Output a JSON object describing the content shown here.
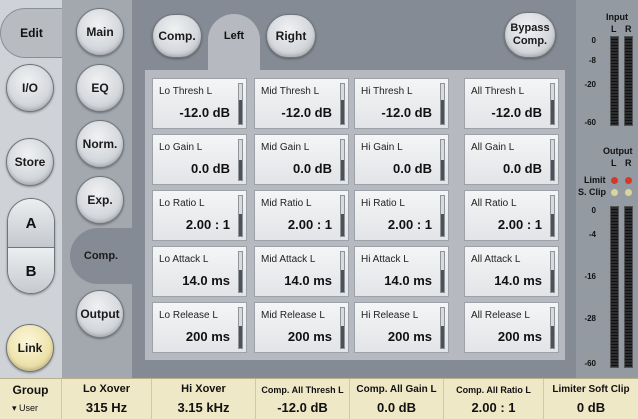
{
  "left_nav": {
    "edit": "Edit",
    "io": "I/O",
    "store": "Store",
    "a": "A",
    "b": "B",
    "link": "Link"
  },
  "sections": {
    "main": "Main",
    "eq": "EQ",
    "norm": "Norm.",
    "exp": "Exp.",
    "comp": "Comp.",
    "output": "Output"
  },
  "tabs": {
    "comp": "Comp.",
    "left": "Left",
    "right": "Right",
    "bypass_line1": "Bypass",
    "bypass_line2": "Comp."
  },
  "params": [
    [
      {
        "label": "Lo Thresh L",
        "value": "-12.0 dB",
        "level": 0.6
      },
      {
        "label": "Mid Thresh L",
        "value": "-12.0 dB",
        "level": 0.6
      },
      {
        "label": "Hi Thresh L",
        "value": "-12.0 dB",
        "level": 0.6
      },
      {
        "label": "All Thresh L",
        "value": "-12.0 dB",
        "level": 0.6
      }
    ],
    [
      {
        "label": "Lo Gain L",
        "value": "0.0 dB",
        "level": 0.5
      },
      {
        "label": "Mid Gain L",
        "value": "0.0 dB",
        "level": 0.5
      },
      {
        "label": "Hi Gain L",
        "value": "0.0 dB",
        "level": 0.5
      },
      {
        "label": "All Gain L",
        "value": "0.0 dB",
        "level": 0.5
      }
    ],
    [
      {
        "label": "Lo Ratio L",
        "value": "2.00 : 1",
        "level": 0.55
      },
      {
        "label": "Mid Ratio L",
        "value": "2.00 : 1",
        "level": 0.55
      },
      {
        "label": "Hi Ratio L",
        "value": "2.00 : 1",
        "level": 0.55
      },
      {
        "label": "All Ratio L",
        "value": "2.00 : 1",
        "level": 0.55
      }
    ],
    [
      {
        "label": "Lo Attack L",
        "value": "14.0 ms",
        "level": 0.55
      },
      {
        "label": "Mid Attack L",
        "value": "14.0 ms",
        "level": 0.55
      },
      {
        "label": "Hi Attack L",
        "value": "14.0 ms",
        "level": 0.55
      },
      {
        "label": "All Attack L",
        "value": "14.0 ms",
        "level": 0.55
      }
    ],
    [
      {
        "label": "Lo Release L",
        "value": "200 ms",
        "level": 0.55
      },
      {
        "label": "Mid Release L",
        "value": "200 ms",
        "level": 0.55
      },
      {
        "label": "Hi Release L",
        "value": "200 ms",
        "level": 0.55
      },
      {
        "label": "All Release L",
        "value": "200 ms",
        "level": 0.55
      }
    ]
  ],
  "meters": {
    "input_title": "Input",
    "output_title": "Output",
    "l": "L",
    "r": "R",
    "input_ticks": [
      "0",
      "-8",
      "-20",
      "-60"
    ],
    "output_ticks": [
      "0",
      "-4",
      "-16",
      "-28",
      "-60"
    ],
    "limit": "Limit",
    "sclip": "S. Clip",
    "limit_color": "#d23a2a",
    "sclip_color": "#d8d4a0"
  },
  "bottom": {
    "group_title": "Group",
    "group_value": "User",
    "lo_xover_title": "Lo Xover",
    "lo_xover_value": "315 Hz",
    "hi_xover_title": "Hi Xover",
    "hi_xover_value": "3.15 kHz",
    "all_thresh_title": "Comp. All Thresh L",
    "all_thresh_value": "-12.0 dB",
    "all_gain_title": "Comp. All Gain L",
    "all_gain_value": "0.0 dB",
    "all_ratio_title": "Comp. All Ratio L",
    "all_ratio_value": "2.00 : 1",
    "limiter_title": "Limiter Soft Clip",
    "limiter_value": "0 dB"
  }
}
